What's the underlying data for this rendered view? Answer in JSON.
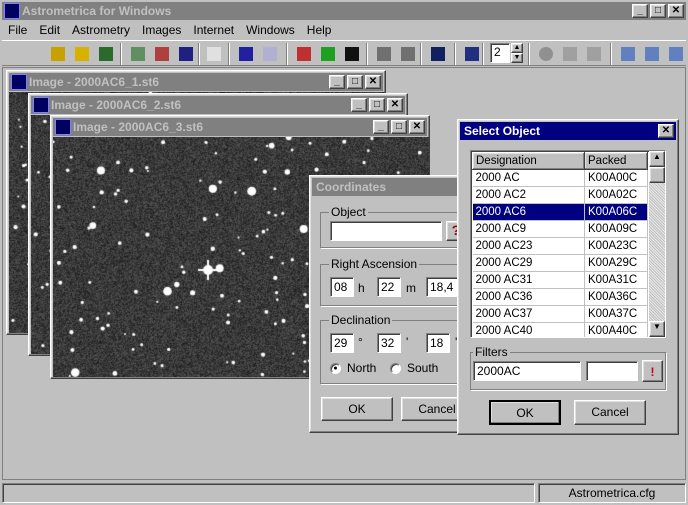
{
  "app": {
    "title": "Astrometrica for Windows"
  },
  "menu": [
    "File",
    "Edit",
    "Astrometry",
    "Images",
    "Internet",
    "Windows",
    "Help"
  ],
  "toolbar": {
    "icons": [
      "open-image-icon",
      "open-folder-icon",
      "open-dark-icon",
      "flat-icon",
      "dark-icon",
      "blink-icon",
      "report-icon",
      "delete-image-icon",
      "close-image-icon",
      "crosshair-icon",
      "color-icon",
      "invert-icon",
      "zoom-in-icon",
      "zoom-out-icon",
      "stars-icon",
      "catalog-icon",
      "record-icon",
      "play-icon",
      "play-next-icon",
      "zoom-window-icon",
      "zoom-window-in-icon",
      "zoom-window-out-icon"
    ],
    "stepper_value": "2"
  },
  "windows": [
    {
      "title": "Image - 2000AC6_1.st6"
    },
    {
      "title": "Image - 2000AC6_2.st6"
    },
    {
      "title": "Image - 2000AC6_3.st6"
    }
  ],
  "coordinates": {
    "title": "Coordinates",
    "object_label": "Object",
    "object_value": "",
    "help_glyph": "?",
    "ra_label": "Right Ascension",
    "ra_h": "08",
    "ra_h_unit": "h",
    "ra_m": "22",
    "ra_m_unit": "m",
    "ra_s": "18,4",
    "dec_label": "Declination",
    "dec_d": "29",
    "dec_d_unit": "°",
    "dec_m": "32",
    "dec_m_unit": "'",
    "dec_s": "18",
    "dec_s_unit": "''",
    "north": "North",
    "south": "South",
    "hemisphere": "North",
    "ok": "OK",
    "cancel": "Cancel"
  },
  "select": {
    "title": "Select Object",
    "columns": [
      "Designation",
      "Packed"
    ],
    "rows": [
      [
        "2000 AC",
        "K00A00C"
      ],
      [
        "2000 AC2",
        "K00A02C"
      ],
      [
        "2000 AC6",
        "K00A06C"
      ],
      [
        "2000 AC9",
        "K00A09C"
      ],
      [
        "2000 AC23",
        "K00A23C"
      ],
      [
        "2000 AC29",
        "K00A29C"
      ],
      [
        "2000 AC31",
        "K00A31C"
      ],
      [
        "2000 AC36",
        "K00A36C"
      ],
      [
        "2000 AC37",
        "K00A37C"
      ],
      [
        "2000 AC40",
        "K00A40C"
      ]
    ],
    "selected_index": 2,
    "filters_label": "Filters",
    "filter1": "2000AC",
    "filter2": "",
    "apply_glyph": "!",
    "ok": "OK",
    "cancel": "Cancel"
  },
  "status": {
    "config": "Astrometrica.cfg"
  }
}
